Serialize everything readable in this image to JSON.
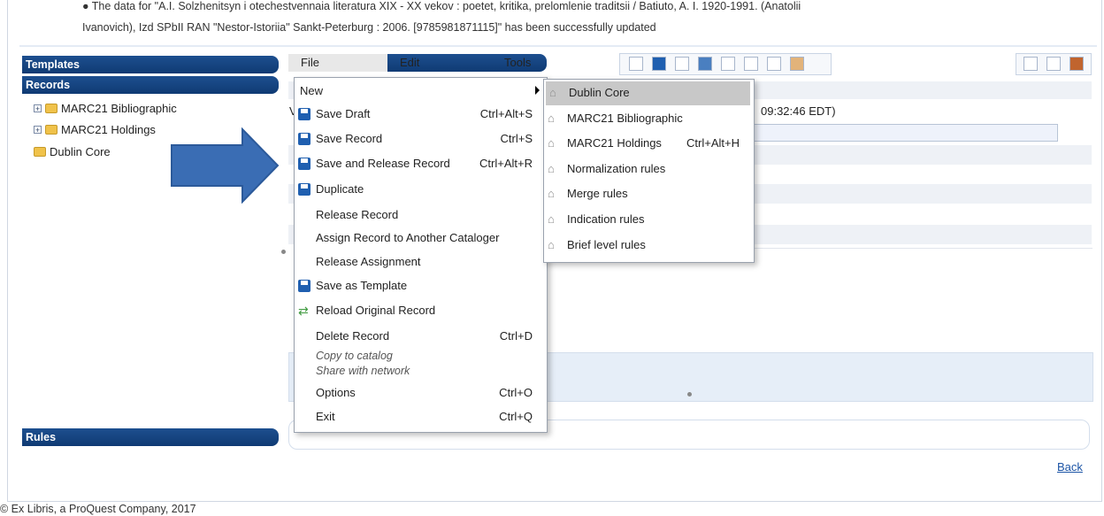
{
  "message": {
    "line1": "● The data for \"A.I. Solzhenitsyn i otechestvennaia literatura XIX - XX vekov : poetet, kritika, prelomlenie traditsii / Batiuto, A. I. 1920-1991. (Anatolii",
    "line2": "Ivanovich), Izd SPbII RAN \"Nestor-Istoriia\" Sankt-Peterburg : 2006. [9785981871115]\" has been successfully updated"
  },
  "left_panel": {
    "templates_label": "Templates",
    "records_label": "Records",
    "rules_label": "Rules",
    "tree": [
      {
        "label": "MARC21 Bibliographic",
        "expandable": true
      },
      {
        "label": "MARC21 Holdings",
        "expandable": true
      },
      {
        "label": "Dublin Core",
        "expandable": false
      }
    ]
  },
  "menubar": {
    "file": "File",
    "edit": "Edit",
    "tools": "Tools"
  },
  "file_menu": [
    {
      "label": "New",
      "shortcut": "",
      "icon": "",
      "submenu": true
    },
    {
      "label": "Save Draft",
      "shortcut": "Ctrl+Alt+S",
      "icon": "save-icon"
    },
    {
      "label": "Save Record",
      "shortcut": "Ctrl+S",
      "icon": "save-icon"
    },
    {
      "label": "Save and Release Record",
      "shortcut": "Ctrl+Alt+R",
      "icon": "save-icon"
    },
    {
      "label": "Duplicate",
      "shortcut": "",
      "icon": "save-icon"
    },
    {
      "label": "Release Record",
      "shortcut": "",
      "icon": ""
    },
    {
      "label": "Assign Record to Another Cataloger",
      "shortcut": "",
      "icon": ""
    },
    {
      "label": "Release Assignment",
      "shortcut": "",
      "icon": ""
    },
    {
      "label": "Save as Template",
      "shortcut": "",
      "icon": "save-icon"
    },
    {
      "label": "Reload Original Record",
      "shortcut": "",
      "icon": "reload-icon"
    },
    {
      "label": "Delete Record",
      "shortcut": "Ctrl+D",
      "icon": ""
    },
    {
      "label": "Copy to catalog",
      "shortcut": "",
      "icon": "",
      "italic": true
    },
    {
      "label": "Share with network",
      "shortcut": "",
      "icon": "",
      "italic": true
    },
    {
      "label": "Options",
      "shortcut": "Ctrl+O",
      "icon": ""
    },
    {
      "label": "Exit",
      "shortcut": "Ctrl+Q",
      "icon": ""
    }
  ],
  "new_submenu": [
    {
      "label": "Dublin Core",
      "shortcut": "",
      "highlighted": true
    },
    {
      "label": "MARC21 Bibliographic",
      "shortcut": ""
    },
    {
      "label": "MARC21 Holdings",
      "shortcut": "Ctrl+Alt+H"
    },
    {
      "label": "Normalization rules",
      "shortcut": ""
    },
    {
      "label": "Merge rules",
      "shortcut": ""
    },
    {
      "label": "Indication rules",
      "shortcut": ""
    },
    {
      "label": "Brief level rules",
      "shortcut": ""
    }
  ],
  "content": {
    "partial_v": "V",
    "timestamp_fragment": "09:32:46 EDT)"
  },
  "back_link": "Back",
  "footer": "© Ex Libris, a ProQuest Company, 2017",
  "colors": {
    "panel_header": "#0f3a73",
    "highlight": "#c8c8c8",
    "arrow": "#3a6db4",
    "link": "#1d55a6"
  }
}
